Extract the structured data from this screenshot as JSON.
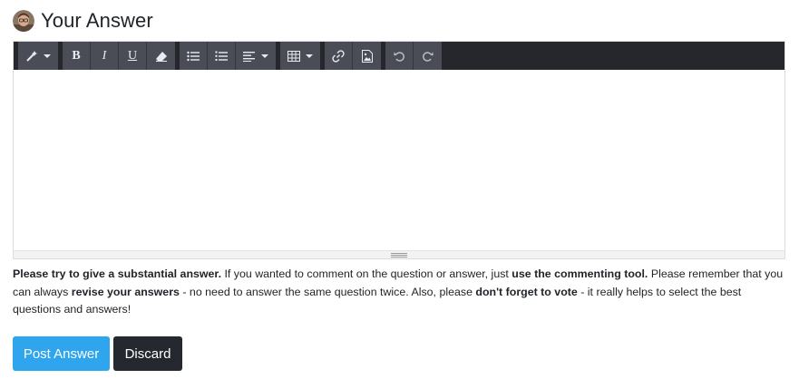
{
  "header": {
    "title": "Your Answer",
    "avatar_icon": "user-avatar"
  },
  "toolbar": {
    "groups": [
      [
        "magic-wand-icon"
      ],
      [
        "bold-icon",
        "italic-icon",
        "underline-icon",
        "eraser-icon"
      ],
      [
        "unordered-list-icon",
        "ordered-list-icon",
        "align-left-icon"
      ],
      [
        "table-icon"
      ],
      [
        "link-icon",
        "picture-icon"
      ],
      [
        "undo-icon",
        "redo-icon"
      ]
    ],
    "bold_label": "B",
    "italic_label": "I",
    "underline_label": "U"
  },
  "editor": {
    "value": ""
  },
  "help": {
    "p1_bold": "Please try to give a substantial answer.",
    "p1_text": " If you wanted to comment on the question or answer, just ",
    "p2_bold": "use the commenting tool.",
    "p2_text": " Please remember that you can always ",
    "p3_bold": "revise your answers",
    "p3_text": " - no need to answer the same question twice. Also, please ",
    "p4_bold": "don't forget to vote",
    "p4_text": " - it really helps to select the best questions and answers!"
  },
  "buttons": {
    "post": "Post Answer",
    "discard": "Discard"
  },
  "colors": {
    "primary": "#2ea5ec",
    "dark": "#25292f",
    "toolbar_bg": "#25272d",
    "toolbar_btn": "#4a4d55"
  }
}
